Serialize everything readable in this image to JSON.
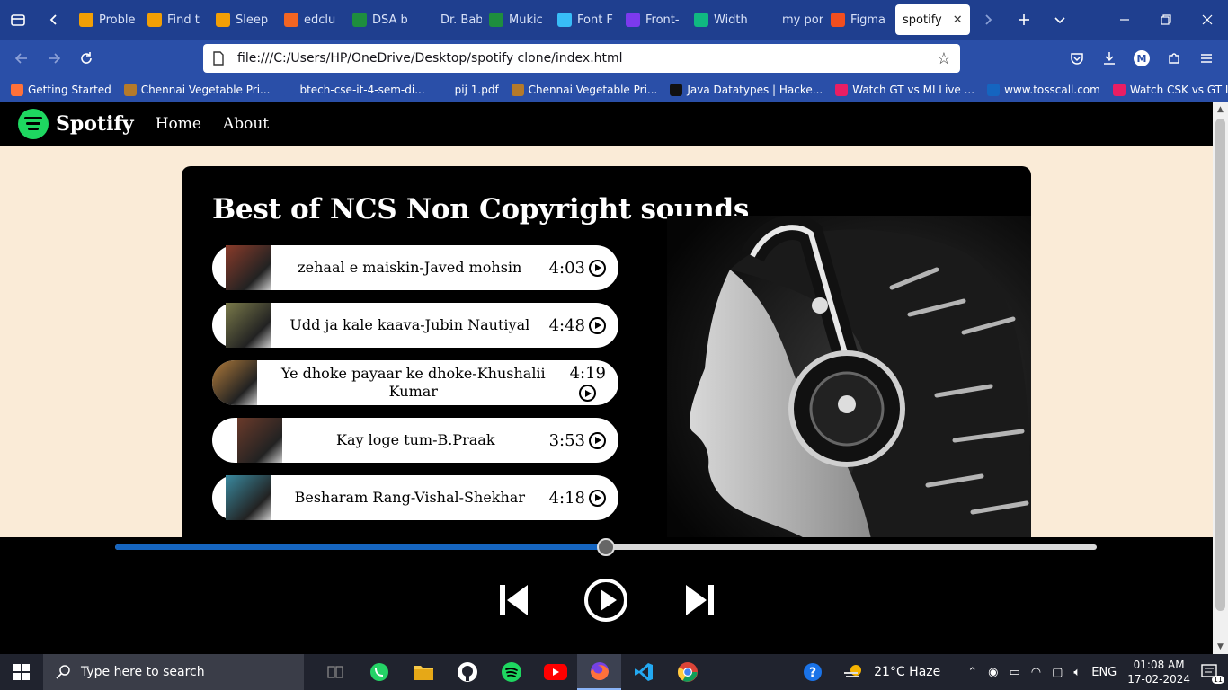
{
  "browser": {
    "tabs": [
      {
        "label": "Proble",
        "fav": "#f29f05"
      },
      {
        "label": "Find t",
        "fav": "#f29f05"
      },
      {
        "label": "Sleep",
        "fav": "#f29f05"
      },
      {
        "label": "edclu",
        "fav": "#f26522"
      },
      {
        "label": "DSA b",
        "fav": "#1e8e3e"
      },
      {
        "label": "Dr. Babasa",
        "fav": ""
      },
      {
        "label": "Mukic",
        "fav": "#1e8e3e"
      },
      {
        "label": "Font F",
        "fav": "#38bdf8"
      },
      {
        "label": "Front-",
        "fav": "#7c3aed"
      },
      {
        "label": "Width",
        "fav": "#10b981"
      },
      {
        "label": "my portfo",
        "fav": ""
      },
      {
        "label": "Figma",
        "fav": "#f24e1e"
      }
    ],
    "active_tab": "spotify",
    "url": "file:///C:/Users/HP/OneDrive/Desktop/spotify clone/index.html",
    "profile_initial": "M",
    "bookmarks": [
      {
        "label": "Getting Started",
        "fav": "#ff7139"
      },
      {
        "label": "Chennai Vegetable Pri...",
        "fav": "#b57a2a"
      },
      {
        "label": "btech-cse-it-4-sem-di...",
        "fav": "#2a4fa8"
      },
      {
        "label": "pij 1.pdf",
        "fav": "#2a4fa8"
      },
      {
        "label": "Chennai Vegetable Pri...",
        "fav": "#b57a2a"
      },
      {
        "label": "Java Datatypes | Hacke...",
        "fav": "#111111"
      },
      {
        "label": "Watch GT vs MI Live ...",
        "fav": "#e91e63"
      },
      {
        "label": "www.tosscall.com",
        "fav": "#1565c0"
      },
      {
        "label": "Watch CSK vs GT Live ...",
        "fav": "#e91e63"
      }
    ]
  },
  "site": {
    "brand": "Spotify",
    "nav": [
      "Home",
      "About"
    ],
    "playlist_title": "Best of NCS Non Copyright sounds",
    "songs": [
      {
        "title": "zehaal e maiskin-Javed mohsin",
        "duration": "4:03",
        "cover": "#8a3b2a"
      },
      {
        "title": "Udd ja kale kaava-Jubin Nautiyal",
        "duration": "4:48",
        "cover": "#7a7a4a"
      },
      {
        "title": "Ye dhoke payaar ke dhoke-Khushalii Kumar",
        "duration": "4:19",
        "cover": "#b07a3a"
      },
      {
        "title": "Kay loge tum-B.Praak",
        "duration": "3:53",
        "cover": "#6a3a2a"
      },
      {
        "title": "Besharam Rang-Vishal-Shekhar",
        "duration": "4:18",
        "cover": "#3a8aa0"
      }
    ],
    "progress_fraction": 0.5
  },
  "taskbar": {
    "search_placeholder": "Type here to search",
    "weather": "21°C  Haze",
    "lang": "ENG",
    "time": "01:08 AM",
    "date": "17-02-2024",
    "notification_count": "11"
  }
}
